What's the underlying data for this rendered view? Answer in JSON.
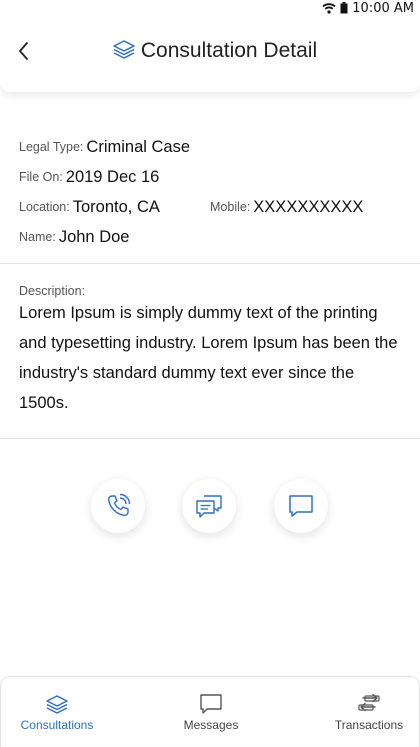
{
  "status_bar": {
    "time": "10:00 AM"
  },
  "header": {
    "title": "Consultation Detail"
  },
  "details": {
    "legal_type_label": "Legal Type:",
    "legal_type_value": "Criminal Case",
    "file_on_label": "File On:",
    "file_on_value": "2019 Dec 16",
    "location_label": "Location:",
    "location_value": "Toronto, CA",
    "mobile_label": "Mobile:",
    "mobile_value": "XXXXXXXXXX",
    "name_label": "Name:",
    "name_value": "John Doe"
  },
  "description": {
    "label": "Description:",
    "text": "Lorem Ipsum is simply dummy text of the printing and typesetting industry. Lorem Ipsum has been the industry's standard dummy text ever since the 1500s."
  },
  "bottom_nav": {
    "items": [
      {
        "label": "Consultations",
        "icon": "layers-icon",
        "active": true
      },
      {
        "label": "Messages",
        "icon": "message-icon",
        "active": false
      },
      {
        "label": "Transactions",
        "icon": "transfer-icon",
        "active": false
      }
    ]
  },
  "colors": {
    "accent": "#2f6fc4",
    "icon_muted": "#555555"
  }
}
